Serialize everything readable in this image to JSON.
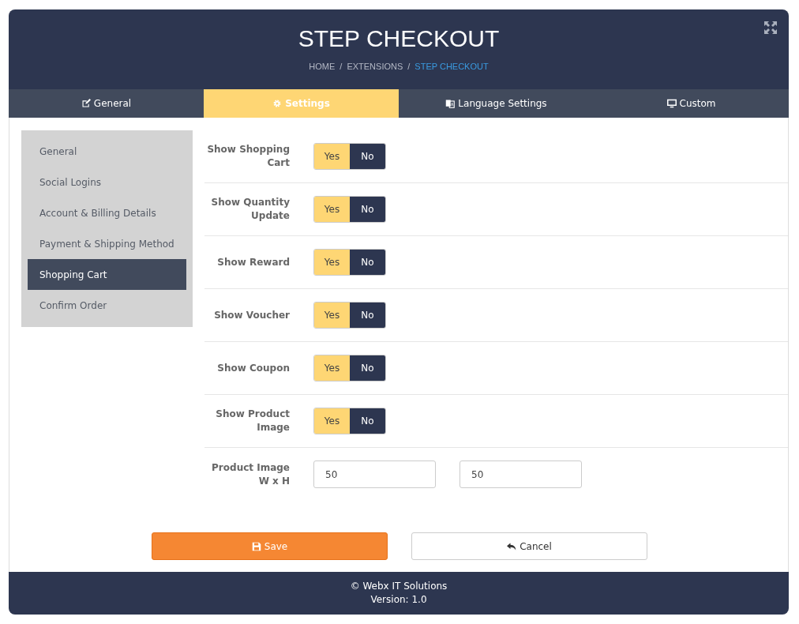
{
  "header": {
    "title": "STEP CHECKOUT",
    "breadcrumbs": [
      {
        "label": "HOME",
        "current": false
      },
      {
        "separator": "/",
        "label": "EXTENSIONS",
        "current": false
      },
      {
        "separator": "/",
        "label": "STEP CHECKOUT",
        "current": true
      }
    ]
  },
  "tabs": [
    {
      "label": "General",
      "kind": "edit",
      "selected": false
    },
    {
      "label": "Settings",
      "kind": "gear",
      "selected": true
    },
    {
      "label": "Language Settings",
      "kind": "language",
      "selected": false
    },
    {
      "label": "Custom",
      "kind": "monitor",
      "selected": false
    }
  ],
  "sidebar": {
    "items": [
      {
        "label": "General",
        "selected": false
      },
      {
        "label": "Social Logins",
        "selected": false
      },
      {
        "label": "Account & Billing Details",
        "selected": false
      },
      {
        "label": "Payment & Shipping Method",
        "selected": false
      },
      {
        "label": "Shopping Cart",
        "selected": true
      },
      {
        "label": "Confirm Order",
        "selected": false
      }
    ]
  },
  "form": {
    "rows": [
      {
        "kind": "toggle",
        "label": "Show Shopping Cart",
        "options": [
          {
            "label": "Yes",
            "selected": true
          },
          {
            "label": "No",
            "selected": false
          }
        ]
      },
      {
        "kind": "toggle",
        "label": "Show Quantity Update",
        "options": [
          {
            "label": "Yes",
            "selected": true
          },
          {
            "label": "No",
            "selected": false
          }
        ]
      },
      {
        "kind": "toggle",
        "label": "Show Reward",
        "options": [
          {
            "label": "Yes",
            "selected": true
          },
          {
            "label": "No",
            "selected": false
          }
        ]
      },
      {
        "kind": "toggle",
        "label": "Show Voucher",
        "options": [
          {
            "label": "Yes",
            "selected": true
          },
          {
            "label": "No",
            "selected": false
          }
        ]
      },
      {
        "kind": "toggle",
        "label": "Show Coupon",
        "options": [
          {
            "label": "Yes",
            "selected": true
          },
          {
            "label": "No",
            "selected": false
          }
        ]
      },
      {
        "kind": "toggle",
        "label": "Show Product Image",
        "options": [
          {
            "label": "Yes",
            "selected": true
          },
          {
            "label": "No",
            "selected": false
          }
        ]
      },
      {
        "kind": "inputs",
        "label": "Product Image W x H",
        "values": [
          "50",
          "50"
        ]
      }
    ]
  },
  "buttons": [
    {
      "kind": "save",
      "label": "Save"
    },
    {
      "kind": "cancel",
      "label": "Cancel"
    }
  ],
  "footer": {
    "lines": [
      "© Webx IT Solutions",
      "Version: 1.0"
    ]
  }
}
